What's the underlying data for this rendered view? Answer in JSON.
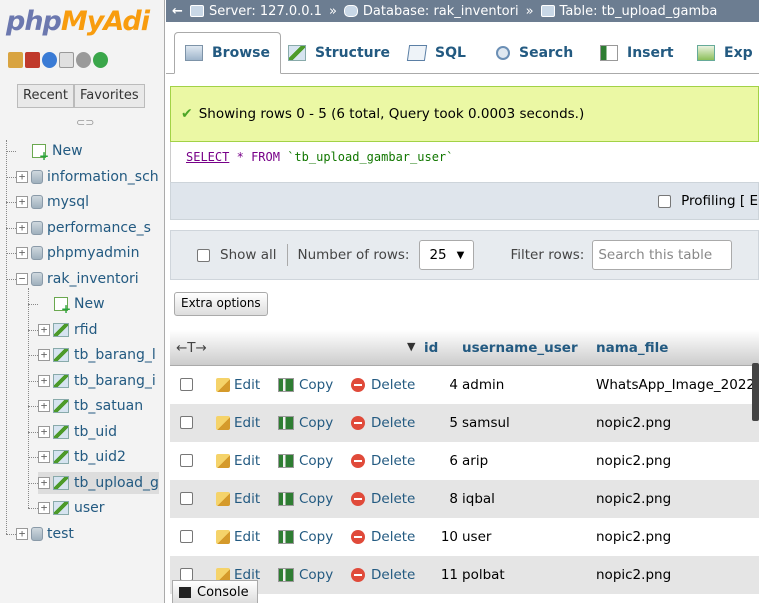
{
  "app": {
    "logo_php": "php",
    "logo_myadmin": "MyAdi"
  },
  "nav": {
    "tabs": [
      "Recent",
      "Favorites"
    ],
    "collapse_icon": "link-icon",
    "tree": [
      {
        "label": "New",
        "type": "new"
      },
      {
        "label": "information_sch",
        "type": "db"
      },
      {
        "label": "mysql",
        "type": "db"
      },
      {
        "label": "performance_s",
        "type": "db"
      },
      {
        "label": "phpmyadmin",
        "type": "db"
      },
      {
        "label": "rak_inventori",
        "type": "db",
        "expanded": true
      },
      {
        "label": "New",
        "type": "new"
      },
      {
        "label": "rfid",
        "type": "table"
      },
      {
        "label": "tb_barang_l",
        "type": "table"
      },
      {
        "label": "tb_barang_i",
        "type": "table"
      },
      {
        "label": "tb_satuan",
        "type": "table"
      },
      {
        "label": "tb_uid",
        "type": "table"
      },
      {
        "label": "tb_uid2",
        "type": "table"
      },
      {
        "label": "tb_upload_g",
        "type": "table",
        "selected": true
      },
      {
        "label": "user",
        "type": "table"
      },
      {
        "label": "test",
        "type": "db"
      }
    ]
  },
  "breadcrumb": {
    "server": "Server: 127.0.0.1",
    "database": "Database: rak_inventori",
    "table": "Table: tb_upload_gamba",
    "separator": "»"
  },
  "tabs": [
    {
      "label": "Browse",
      "icon": "browse-icon",
      "active": true
    },
    {
      "label": "Structure",
      "icon": "structure-icon"
    },
    {
      "label": "SQL",
      "icon": "sql-icon"
    },
    {
      "label": "Search",
      "icon": "search-icon"
    },
    {
      "label": "Insert",
      "icon": "insert-icon"
    },
    {
      "label": "Exp",
      "icon": "export-icon"
    }
  ],
  "message": {
    "text": "Showing rows 0 - 5 (6 total, Query took 0.0003 seconds.)"
  },
  "query": {
    "select": "SELECT",
    "star": "*",
    "from": "FROM",
    "table": "`tb_upload_gambar_user`"
  },
  "profiling": {
    "label": "Profiling [ E"
  },
  "controls": {
    "show_all": "Show all",
    "number_of_rows_label": "Number of rows:",
    "number_of_rows_value": "25",
    "filter_label": "Filter rows:",
    "filter_placeholder": "Search this table"
  },
  "extra_options": "Extra options",
  "table": {
    "columns": [
      "id",
      "username_user",
      "nama_file"
    ],
    "arrows": "←T→",
    "sort_icon": "▼",
    "actions": {
      "edit": "Edit",
      "copy": "Copy",
      "delete": "Delete"
    },
    "rows": [
      {
        "id": "4",
        "username_user": "admin",
        "nama_file": "WhatsApp_Image_2022"
      },
      {
        "id": "5",
        "username_user": "samsul",
        "nama_file": "nopic2.png"
      },
      {
        "id": "6",
        "username_user": "arip",
        "nama_file": "nopic2.png"
      },
      {
        "id": "8",
        "username_user": "iqbal",
        "nama_file": "nopic2.png"
      },
      {
        "id": "10",
        "username_user": "user",
        "nama_file": "nopic2.png"
      },
      {
        "id": "11",
        "username_user": "polbat",
        "nama_file": "nopic2.png"
      }
    ]
  },
  "console": {
    "label": "Console"
  }
}
